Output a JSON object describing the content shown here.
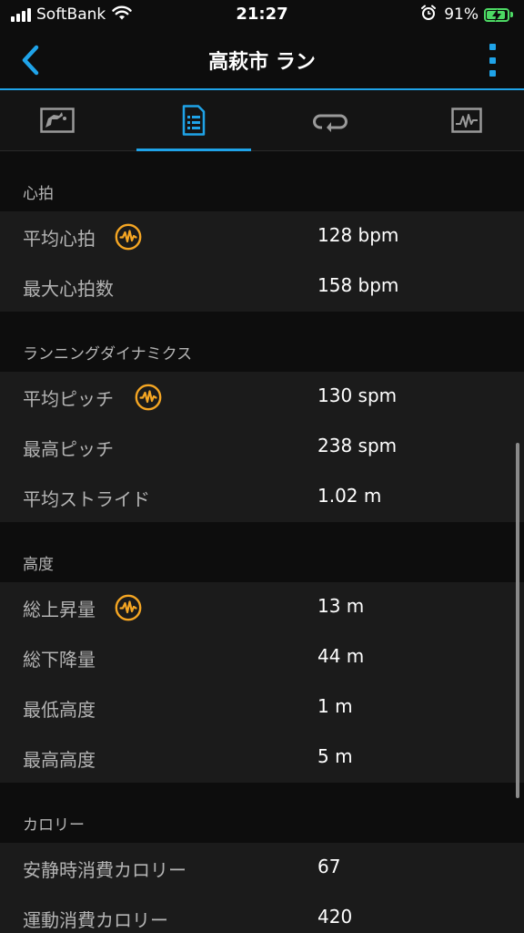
{
  "status_bar": {
    "carrier": "SoftBank",
    "time": "21:27",
    "battery_percent": "91%",
    "battery_level": 0.91,
    "battery_color": "#4cd964"
  },
  "nav": {
    "title": "高萩市 ラン",
    "accent_color": "#1fa3e8"
  },
  "tabs": [
    {
      "icon": "map-icon",
      "active": false
    },
    {
      "icon": "details-list-icon",
      "active": true
    },
    {
      "icon": "laps-loop-icon",
      "active": false
    },
    {
      "icon": "chart-graph-icon",
      "active": false
    }
  ],
  "sections": [
    {
      "title": "心拍",
      "rows": [
        {
          "label": "平均心拍",
          "value": "128 bpm",
          "badge": true
        },
        {
          "label": "最大心拍数",
          "value": "158 bpm",
          "badge": false
        }
      ]
    },
    {
      "title": "ランニングダイナミクス",
      "rows": [
        {
          "label": "平均ピッチ",
          "value": "130 spm",
          "badge": true
        },
        {
          "label": "最高ピッチ",
          "value": "238 spm",
          "badge": false
        },
        {
          "label": "平均ストライド",
          "value": "1.02 m",
          "badge": false
        }
      ]
    },
    {
      "title": "高度",
      "rows": [
        {
          "label": "総上昇量",
          "value": "13 m",
          "badge": true
        },
        {
          "label": "総下降量",
          "value": "44 m",
          "badge": false
        },
        {
          "label": "最低高度",
          "value": "1 m",
          "badge": false
        },
        {
          "label": "最高高度",
          "value": "5 m",
          "badge": false
        }
      ]
    },
    {
      "title": "カロリー",
      "rows": [
        {
          "label": "安静時消費カロリー",
          "value": "67",
          "badge": false
        },
        {
          "label": "運動消費カロリー",
          "value": "420",
          "badge": false
        }
      ]
    }
  ],
  "badge_icon": "performance-wave-icon",
  "badge_color": "#f5a623"
}
